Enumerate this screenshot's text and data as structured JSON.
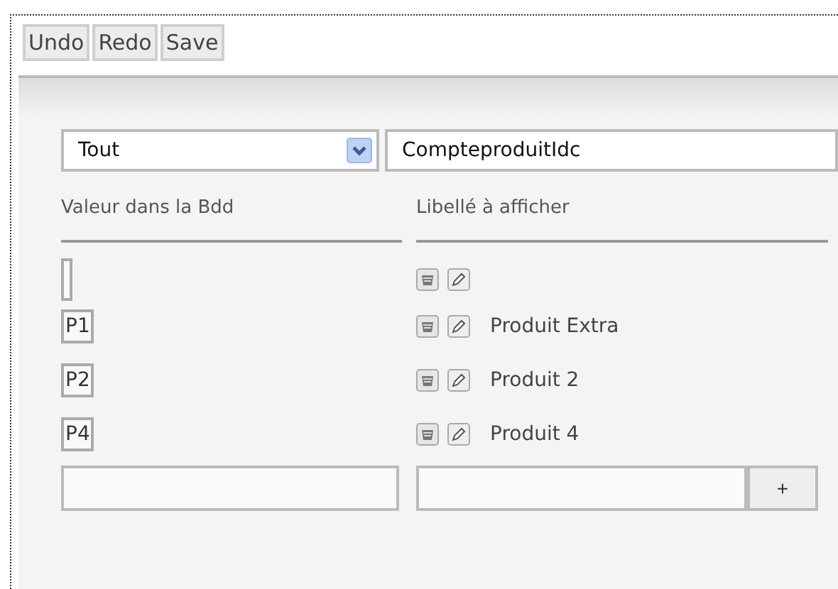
{
  "toolbar": {
    "buttons": [
      "Undo",
      "Redo",
      "Save"
    ]
  },
  "filter": {
    "select": {
      "value": "Tout"
    },
    "name_field": {
      "value": "CompteproduitIdc"
    }
  },
  "columns": [
    "Valeur dans la Bdd",
    "Libellé à afficher"
  ],
  "rows": [
    {},
    {
      "value": "P1",
      "label": "Produit Extra"
    },
    {
      "value": "P2",
      "label": "Produit 2"
    },
    {
      "value": "P4",
      "label": "Produit 4"
    }
  ],
  "new_row": {
    "add_button": "+"
  }
}
